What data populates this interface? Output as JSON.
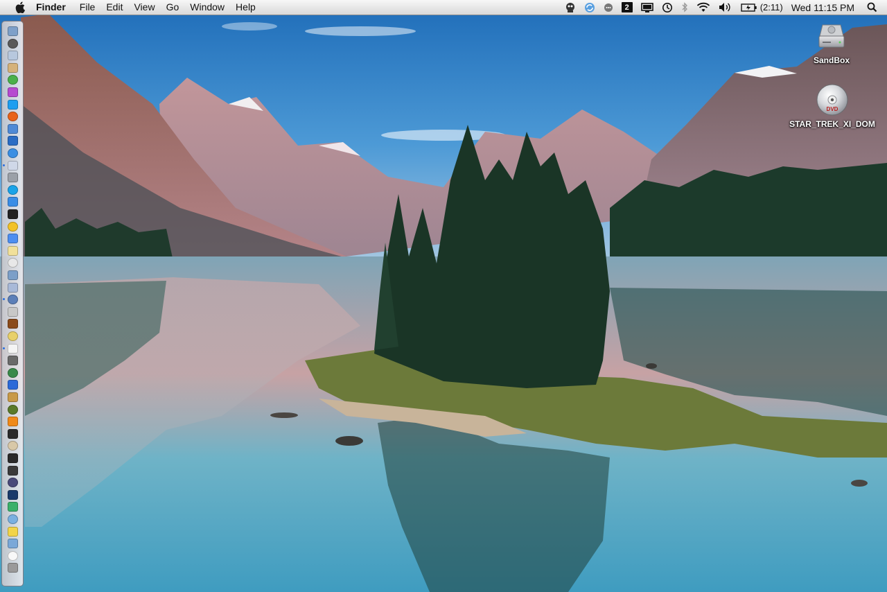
{
  "menubar": {
    "app_name": "Finder",
    "menus": [
      "File",
      "Edit",
      "View",
      "Go",
      "Window",
      "Help"
    ],
    "space_number": "2",
    "battery_time": "(2:11)",
    "clock": "Wed 11:15 PM"
  },
  "desktop": {
    "items": [
      {
        "label": "SandBox",
        "icon": "hard-drive-icon"
      },
      {
        "label": "STAR_TREK_XI_DOM",
        "icon": "dvd-disc-icon",
        "disc_badge": "DVD"
      }
    ]
  },
  "dock": {
    "orientation": "left",
    "app_count": 48
  },
  "colors": {
    "sky": "#2d7fc1",
    "lake": "#4a9bb8",
    "mountain": "#9a7274",
    "forest": "#1f3a2c",
    "menubar": "#e8e8e8"
  }
}
